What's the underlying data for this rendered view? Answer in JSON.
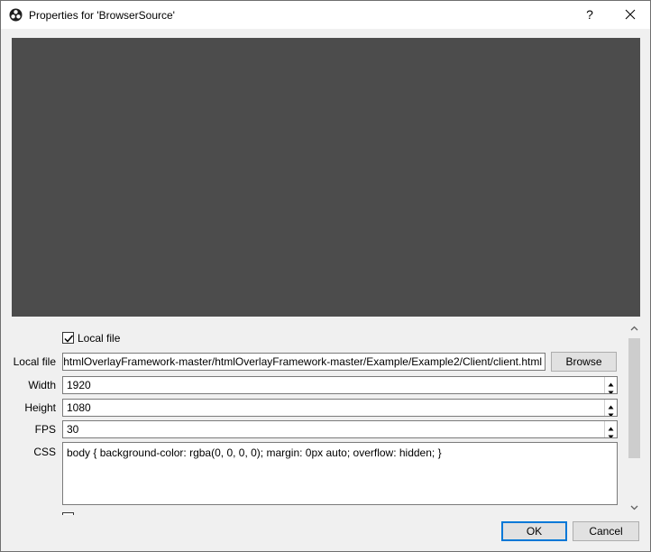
{
  "window": {
    "title": "Properties for 'BrowserSource'",
    "help_glyph": "?",
    "app_icon": "obs-logo-icon",
    "close_icon": "close-icon"
  },
  "form": {
    "local_file_checkbox": {
      "label": "Local file",
      "checked": true
    },
    "local_file": {
      "label": "Local file",
      "value": "C:/Users/Downloads/htmlOverlayFramework-master/htmlOverlayFramework-master/Example/Example2/Client/client.html",
      "browse_label": "Browse"
    },
    "width": {
      "label": "Width",
      "value": "1920"
    },
    "height": {
      "label": "Height",
      "value": "1080"
    },
    "fps": {
      "label": "FPS",
      "value": "30"
    },
    "css": {
      "label": "CSS",
      "value": "body { background-color: rgba(0, 0, 0, 0); margin: 0px auto; overflow: hidden; }"
    }
  },
  "buttons": {
    "ok": "OK",
    "cancel": "Cancel"
  },
  "colors": {
    "preview_bg": "#4c4c4c",
    "accent": "#0078d7"
  }
}
